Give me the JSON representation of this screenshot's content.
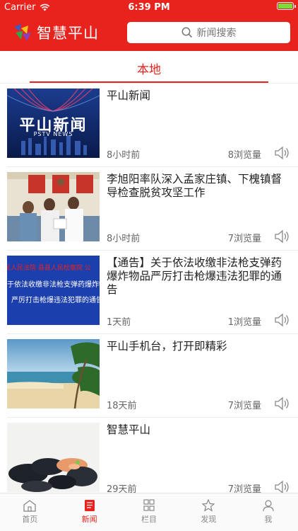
{
  "status": {
    "carrier": "Carrier",
    "time": "6:39 PM",
    "battery_level": 1.0
  },
  "header": {
    "logo_text": "智慧平山",
    "search_placeholder": "新闻搜索"
  },
  "tabs": {
    "local": "本地"
  },
  "news": [
    {
      "title": "平山新闻",
      "time": "8小时前",
      "views": "8浏览量",
      "thumb_text": "平山新闻",
      "thumb_sub": "PSTV NEWS"
    },
    {
      "title": "李旭阳率队深入孟家庄镇、下槐镇督导检查脱贫攻坚工作",
      "time": "8小时前",
      "views": "7浏览量"
    },
    {
      "title": "【通告】关于依法收缴非法枪支弹药爆炸物品严厉打击枪爆违法犯罪的通告",
      "time": "1天前",
      "views": "1浏览量",
      "thumb_lines": [
        "民人民法院  县县人民检察院  公",
        "于依法收缴非法枪支弹药爆炸物",
        "严厉打击枪爆违法犯罪的通告"
      ]
    },
    {
      "title": "平山手机台，打开即精彩",
      "time": "18天前",
      "views": "7浏览量"
    },
    {
      "title": "智慧平山",
      "time": "29天前",
      "views": "7浏览量"
    }
  ],
  "bottom_nav": {
    "home": "首页",
    "news": "新闻",
    "columns": "栏目",
    "discover": "发现",
    "me": "我"
  },
  "colors": {
    "brand": "#e8221c",
    "inactive": "#888888"
  }
}
